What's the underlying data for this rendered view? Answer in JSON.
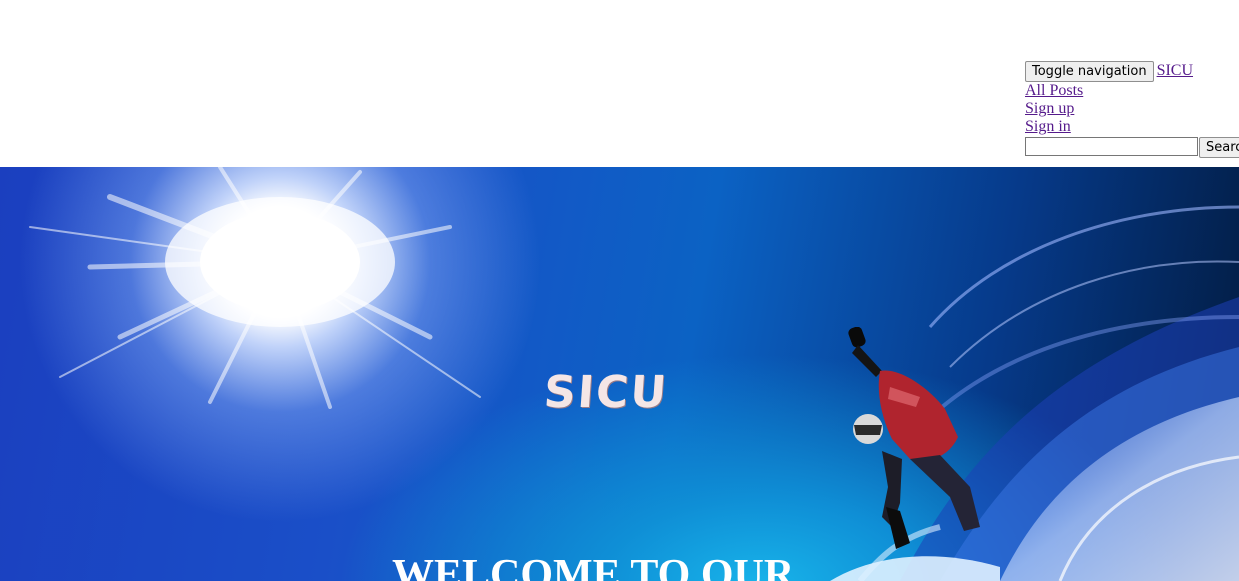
{
  "navbar": {
    "toggle_label": "Toggle navigation",
    "brand": "SICU",
    "links": [
      {
        "label": "All Posts"
      },
      {
        "label": "Sign up"
      },
      {
        "label": "Sign in"
      }
    ],
    "search": {
      "value": "",
      "button_label": "Search"
    }
  },
  "hero": {
    "logo": "SICU",
    "heading": "WELCOME TO OUR"
  },
  "colors": {
    "link": "#551a8b",
    "hero_blue": "#1a4fc8",
    "hero_text": "#ffffff"
  }
}
